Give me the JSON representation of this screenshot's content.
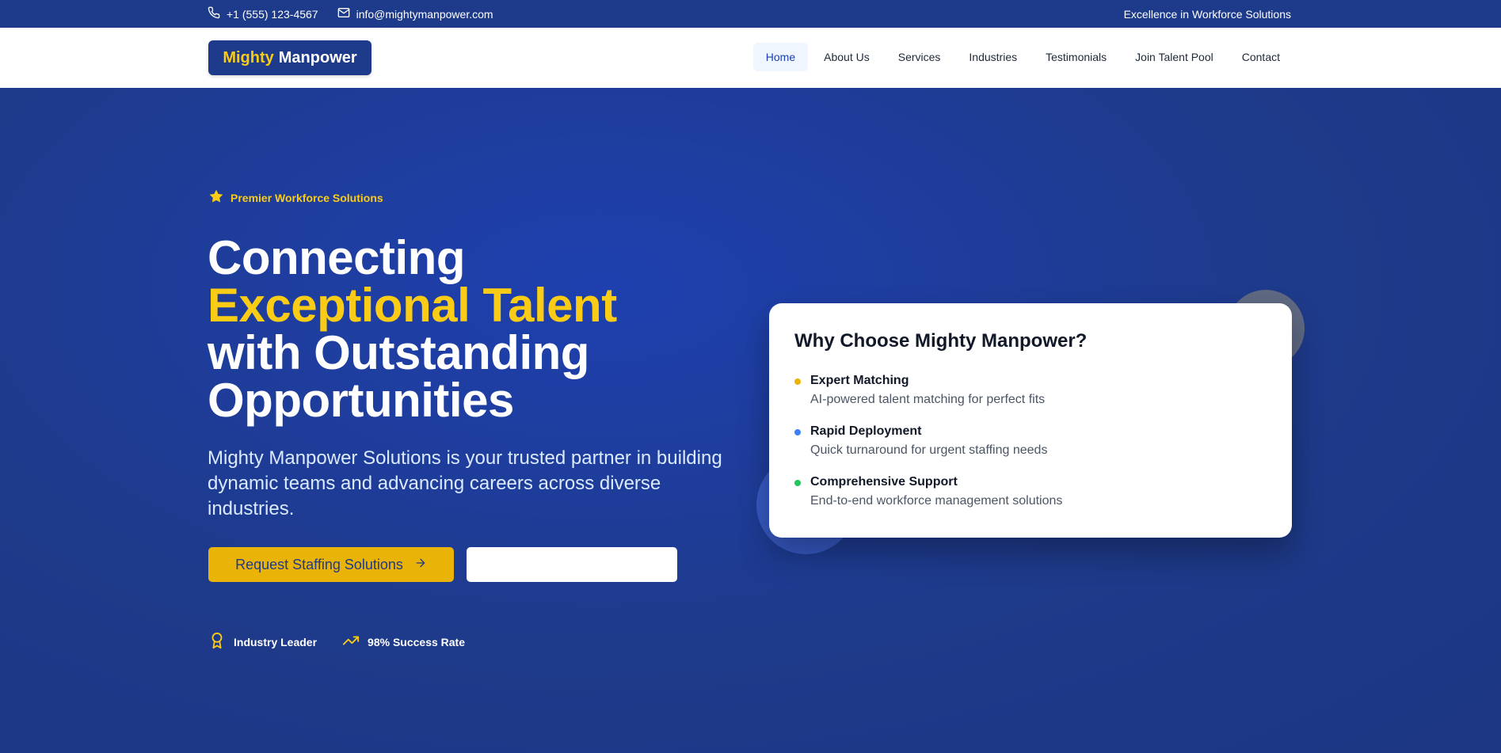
{
  "topbar": {
    "phone": "+1 (555) 123-4567",
    "email": "info@mightymanpower.com",
    "tagline": "Excellence in Workforce Solutions"
  },
  "nav": {
    "logo_first": "Mighty",
    "logo_second": "Manpower",
    "items": [
      {
        "label": "Home",
        "active": true
      },
      {
        "label": "About Us",
        "active": false
      },
      {
        "label": "Services",
        "active": false
      },
      {
        "label": "Industries",
        "active": false
      },
      {
        "label": "Testimonials",
        "active": false
      },
      {
        "label": "Join Talent Pool",
        "active": false
      },
      {
        "label": "Contact",
        "active": false
      }
    ]
  },
  "hero": {
    "badge": "Premier Workforce Solutions",
    "headline_line1": "Connecting",
    "headline_highlight": "Exceptional Talent",
    "headline_line3": "with Outstanding",
    "headline_line4": "Opportunities",
    "lead": "Mighty Manpower Solutions is your trusted partner in building dynamic teams and advancing careers across diverse industries.",
    "primary_button": "Request Staffing Solutions",
    "secondary_button": "",
    "stats": [
      {
        "label": "Industry Leader",
        "icon": "award-icon"
      },
      {
        "label": "98% Success Rate",
        "icon": "trending-up-icon"
      }
    ]
  },
  "card": {
    "title": "Why Choose Mighty Manpower?",
    "features": [
      {
        "title": "Expert Matching",
        "desc": "AI-powered talent matching for perfect fits",
        "color": "#eab308"
      },
      {
        "title": "Rapid Deployment",
        "desc": "Quick turnaround for urgent staffing needs",
        "color": "#3b82f6"
      },
      {
        "title": "Comprehensive Support",
        "desc": "End-to-end workforce management solutions",
        "color": "#22c55e"
      }
    ]
  },
  "colors": {
    "brand_blue": "#1e3a8a",
    "accent_yellow": "#facc15",
    "button_yellow": "#eab308"
  }
}
